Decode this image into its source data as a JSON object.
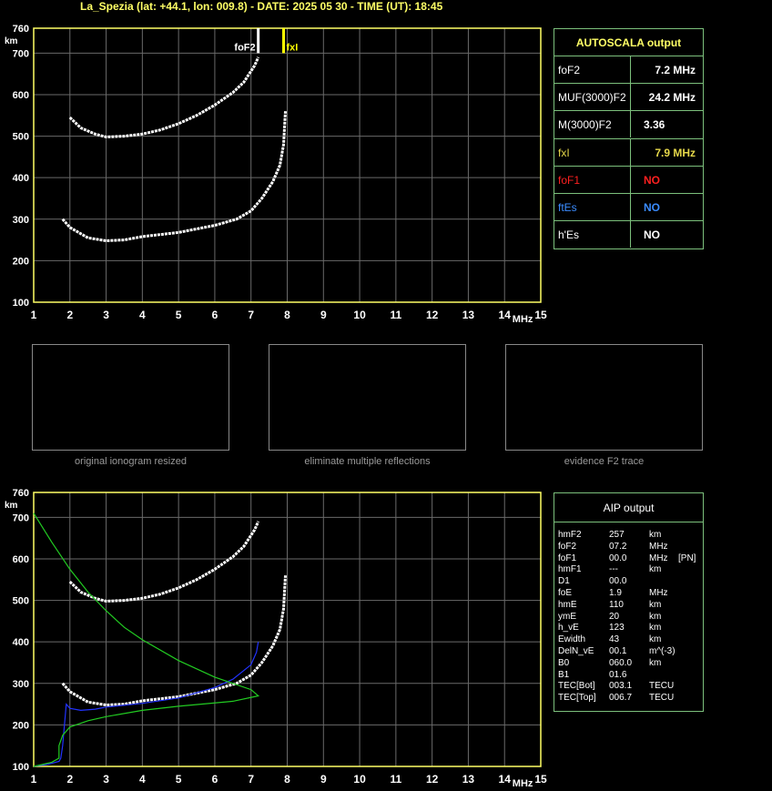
{
  "header": {
    "title": "La_Spezia (lat: +44.1, lon: 009.8) - DATE: 2025 05 30 - TIME (UT): 18:45"
  },
  "chart_data": [
    {
      "type": "scatter",
      "ylabel": "km",
      "xlabel": "MHz",
      "xlim": [
        1,
        15
      ],
      "ylim": [
        100,
        760
      ],
      "x_ticks": [
        "1",
        "2",
        "3",
        "4",
        "5",
        "6",
        "7",
        "8",
        "9",
        "10",
        "11",
        "12",
        "13",
        "14",
        "15"
      ],
      "y_ticks": [
        "100",
        "200",
        "300",
        "400",
        "500",
        "600",
        "700",
        "760"
      ],
      "grid": true,
      "markers": [
        {
          "label": "foF2",
          "x": 7.2,
          "color": "#ffffff"
        },
        {
          "label": "fxI",
          "x": 7.9,
          "color": "#ffff00"
        }
      ],
      "traces": [
        {
          "name": "",
          "color": "#ffffff",
          "points": [
            [
              1.8,
              300
            ],
            [
              2.0,
              280
            ],
            [
              2.5,
              255
            ],
            [
              3.0,
              248
            ],
            [
              3.5,
              250
            ],
            [
              4.0,
              258
            ],
            [
              5.0,
              268
            ],
            [
              6.0,
              285
            ],
            [
              6.6,
              300
            ],
            [
              7.0,
              320
            ],
            [
              7.3,
              350
            ],
            [
              7.6,
              390
            ],
            [
              7.8,
              430
            ],
            [
              7.9,
              480
            ],
            [
              7.95,
              560
            ]
          ]
        },
        {
          "name": "",
          "color": "#ffffff",
          "points": [
            [
              2.0,
              545
            ],
            [
              2.3,
              520
            ],
            [
              2.7,
              505
            ],
            [
              3.0,
              498
            ],
            [
              3.5,
              500
            ],
            [
              4.0,
              505
            ],
            [
              4.5,
              515
            ],
            [
              5.0,
              530
            ],
            [
              5.5,
              550
            ],
            [
              6.0,
              575
            ],
            [
              6.5,
              605
            ],
            [
              6.8,
              630
            ],
            [
              7.1,
              670
            ],
            [
              7.2,
              690
            ]
          ]
        }
      ]
    },
    {
      "type": "scatter",
      "ylabel": "km",
      "xlabel": "MHz",
      "xlim": [
        1,
        15
      ],
      "ylim": [
        100,
        760
      ],
      "x_ticks": [
        "1",
        "2",
        "3",
        "4",
        "5",
        "6",
        "7",
        "8",
        "9",
        "10",
        "11",
        "12",
        "13",
        "14",
        "15"
      ],
      "y_ticks": [
        "100",
        "200",
        "300",
        "400",
        "500",
        "600",
        "700",
        "760"
      ],
      "grid": true,
      "traces": [
        {
          "name": "",
          "color": "#ffffff",
          "points": [
            [
              1.8,
              300
            ],
            [
              2.0,
              280
            ],
            [
              2.5,
              255
            ],
            [
              3.0,
              248
            ],
            [
              3.5,
              250
            ],
            [
              4.0,
              258
            ],
            [
              5.0,
              268
            ],
            [
              6.0,
              285
            ],
            [
              6.6,
              300
            ],
            [
              7.0,
              320
            ],
            [
              7.3,
              350
            ],
            [
              7.6,
              390
            ],
            [
              7.8,
              430
            ],
            [
              7.9,
              480
            ],
            [
              7.95,
              560
            ]
          ]
        },
        {
          "name": "",
          "color": "#ffffff",
          "points": [
            [
              2.0,
              545
            ],
            [
              2.3,
              520
            ],
            [
              2.7,
              505
            ],
            [
              3.0,
              498
            ],
            [
              3.5,
              500
            ],
            [
              4.0,
              505
            ],
            [
              4.5,
              515
            ],
            [
              5.0,
              530
            ],
            [
              5.5,
              550
            ],
            [
              6.0,
              575
            ],
            [
              6.5,
              605
            ],
            [
              6.8,
              630
            ],
            [
              7.1,
              670
            ],
            [
              7.2,
              690
            ]
          ]
        },
        {
          "name": "",
          "color": "#2233ff",
          "points": [
            [
              1.0,
              100
            ],
            [
              1.4,
              105
            ],
            [
              1.7,
              112
            ],
            [
              1.75,
              120
            ],
            [
              1.8,
              150
            ],
            [
              1.9,
              250
            ],
            [
              2.0,
              240
            ],
            [
              2.3,
              235
            ],
            [
              2.7,
              238
            ],
            [
              3.0,
              243
            ],
            [
              4.0,
              252
            ],
            [
              5.0,
              265
            ],
            [
              6.0,
              290
            ],
            [
              6.5,
              310
            ],
            [
              7.0,
              345
            ],
            [
              7.15,
              375
            ],
            [
              7.2,
              400
            ]
          ]
        },
        {
          "name": "",
          "color": "#22cc22",
          "points": [
            [
              1.0,
              710
            ],
            [
              1.5,
              640
            ],
            [
              2.0,
              575
            ],
            [
              2.5,
              520
            ],
            [
              3.0,
              475
            ],
            [
              3.5,
              435
            ],
            [
              4.0,
              405
            ],
            [
              5.0,
              355
            ],
            [
              6.0,
              315
            ],
            [
              6.5,
              300
            ],
            [
              7.0,
              285
            ],
            [
              7.2,
              270
            ],
            [
              6.5,
              257
            ],
            [
              5.0,
              245
            ],
            [
              4.0,
              235
            ],
            [
              3.0,
              220
            ],
            [
              2.5,
              210
            ],
            [
              2.0,
              195
            ],
            [
              1.8,
              175
            ],
            [
              1.7,
              150
            ],
            [
              1.7,
              120
            ],
            [
              1.5,
              110
            ],
            [
              1.0,
              100
            ]
          ]
        }
      ]
    }
  ],
  "thumbnails": [
    {
      "caption": "original ionogram resized"
    },
    {
      "caption": "eliminate multiple reflections"
    },
    {
      "caption": "evidence F2 trace"
    }
  ],
  "autoscala": {
    "title": "AUTOSCALA output",
    "rows": [
      {
        "label": "foF2",
        "value": "7.2 MHz",
        "color": "#ffffff"
      },
      {
        "label": "MUF(3000)F2",
        "value": "24.2 MHz",
        "color": "#ffffff"
      },
      {
        "label": "M(3000)F2",
        "value": "3.36",
        "color": "#ffffff"
      },
      {
        "label": "fxI",
        "value": "7.9 MHz",
        "color": "#e6d84a"
      },
      {
        "label": "foF1",
        "value": "NO",
        "color": "#ff2020"
      },
      {
        "label": "ftEs",
        "value": "NO",
        "color": "#3a8cff"
      },
      {
        "label": "h'Es",
        "value": "NO",
        "color": "#ffffff"
      }
    ]
  },
  "aip": {
    "title": "AIP output",
    "rows": [
      {
        "label": "hmF2",
        "value": "257",
        "unit": "km",
        "extra": ""
      },
      {
        "label": "foF2",
        "value": "07.2",
        "unit": "MHz",
        "extra": ""
      },
      {
        "label": "foF1",
        "value": "00.0",
        "unit": "MHz",
        "extra": "[PN]"
      },
      {
        "label": "hmF1",
        "value": "---",
        "unit": "km",
        "extra": ""
      },
      {
        "label": "D1",
        "value": "00.0",
        "unit": "",
        "extra": ""
      },
      {
        "label": "foE",
        "value": "1.9",
        "unit": "MHz",
        "extra": ""
      },
      {
        "label": "hmE",
        "value": "110",
        "unit": "km",
        "extra": ""
      },
      {
        "label": "ymE",
        "value": "20",
        "unit": "km",
        "extra": ""
      },
      {
        "label": "h_vE",
        "value": "123",
        "unit": "km",
        "extra": ""
      },
      {
        "label": "Ewidth",
        "value": "43",
        "unit": "km",
        "extra": ""
      },
      {
        "label": "DelN_vE",
        "value": "00.1",
        "unit": "m^(-3)",
        "extra": ""
      },
      {
        "label": "B0",
        "value": "060.0",
        "unit": "km",
        "extra": ""
      },
      {
        "label": "B1",
        "value": "01.6",
        "unit": "",
        "extra": ""
      },
      {
        "label": "TEC[Bot]",
        "value": "003.1",
        "unit": "TECU",
        "extra": ""
      },
      {
        "label": "TEC[Top]",
        "value": "006.7",
        "unit": "TECU",
        "extra": ""
      }
    ]
  }
}
